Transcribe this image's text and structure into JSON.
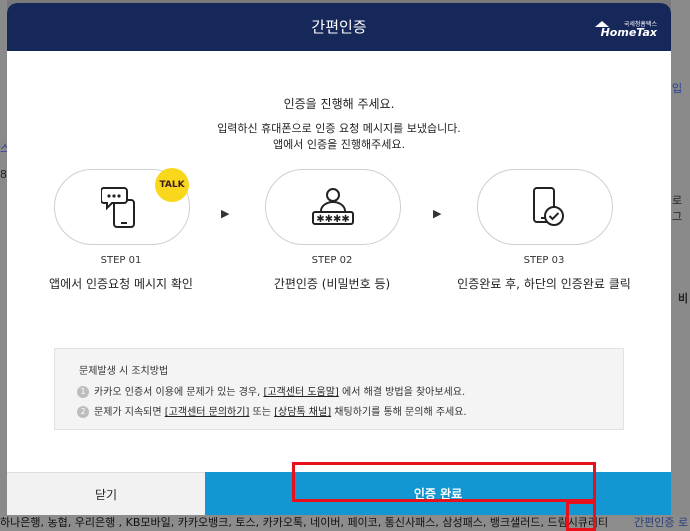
{
  "modal": {
    "title": "간편인증",
    "logo_small": "국세청홈택스",
    "logo_big": "HomeTax"
  },
  "intro": {
    "line1": "인증을 진행해 주세요.",
    "line2": "입력하신 휴대폰으로 인증 요청 메시지를 보냈습니다.",
    "line3": "앱에서 인증을 진행해주세요."
  },
  "steps": [
    {
      "num": "STEP 01",
      "desc": "앱에서 인증요청 메시지 확인",
      "icon": "phone-message-icon",
      "badge": "TALK"
    },
    {
      "num": "STEP 02",
      "desc": "간편인증 (비밀번호 등)",
      "icon": "user-password-icon"
    },
    {
      "num": "STEP 03",
      "desc": "인증완료 후, 하단의 인증완료 클릭",
      "icon": "phone-check-icon"
    }
  ],
  "help": {
    "heading": "문제발생 시 조치방법",
    "items": [
      {
        "n": "1",
        "pre": "카카오 인증서 이용에 문제가 있는 경우, ",
        "link1": "[고객센터 도움말]",
        "post": " 에서 해결 방법을 찾아보세요."
      },
      {
        "n": "2",
        "pre": "문제가 지속되면 ",
        "link1": "[고객센터 문의하기]",
        "mid": " 또는 ",
        "link2": "[상담톡 채널]",
        "post": " 채팅하기를 통해 문의해 주세요."
      }
    ]
  },
  "footer": {
    "close_label": "닫기",
    "done_label": "인증 완료"
  },
  "background": {
    "bottom_text": "하나은행, 농협, 우리은행 , KB모바일, 카카오뱅크, 토스, 카카오톡, 네이버, 페이코, 통신사패스, 삼성패스, 뱅크샐러드, 드림시큐리티",
    "bottom_right": "간편인증 로",
    "right_snippets": [
      "입",
      "로그",
      "비"
    ],
    "left_snippets": [
      "스",
      "8"
    ]
  },
  "colors": {
    "header": "#16285a",
    "primary": "#1297d2",
    "highlight": "#e8101a",
    "kakao": "#f9d71c"
  }
}
